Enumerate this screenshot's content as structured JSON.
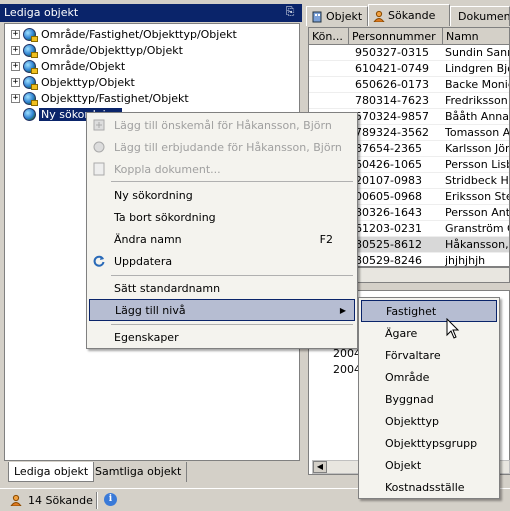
{
  "left_panel": {
    "title": "Lediga objekt",
    "pin_glyph": "↕",
    "tree": [
      {
        "expander": "+",
        "label": "Område/Fastighet/Objekttyp/Objekt"
      },
      {
        "expander": "+",
        "label": "Område/Objekttyp/Objekt"
      },
      {
        "expander": "+",
        "label": "Område/Objekt"
      },
      {
        "expander": "+",
        "label": "Objekttyp/Objekt"
      },
      {
        "expander": "+",
        "label": "Objekttyp/Fastighet/Objekt"
      },
      {
        "expander": "",
        "label": "Ny sökordning"
      }
    ],
    "bottom_tabs": {
      "active": "Lediga objekt",
      "inactive": "Samtliga objekt"
    }
  },
  "right_panel": {
    "tabs": [
      "Objekt",
      "Sökande",
      "Dokument"
    ],
    "grid": {
      "headers": [
        "Kön...",
        "Personnummer",
        "Namn"
      ],
      "rows": [
        {
          "pnr": "950327-0315",
          "name": "Sundin Sanna"
        },
        {
          "pnr": "610421-0749",
          "name": "Lindgren Björn"
        },
        {
          "pnr": "650626-0173",
          "name": "Backe Monica"
        },
        {
          "pnr": "780314-7623",
          "name": "Fredriksson K"
        },
        {
          "pnr": "570324-9857",
          "name": "Bååth Anna"
        },
        {
          "pnr": "789324-3562",
          "name": "Tomasson A..."
        },
        {
          "pnr": "87654-2365",
          "name": "Karlsson Jörg..."
        },
        {
          "pnr": "60426-1065",
          "name": "Persson Lisb..."
        },
        {
          "pnr": "20107-0983",
          "name": "Stridbeck Hel"
        },
        {
          "pnr": "00605-0968",
          "name": "Eriksson Ste..."
        },
        {
          "pnr": "80326-1643",
          "name": "Persson  Ante"
        },
        {
          "pnr": "61203-0231",
          "name": "Granström Co"
        },
        {
          "pnr": "80525-8612",
          "name": "Håkansson, ..."
        },
        {
          "pnr": "80529-8246",
          "name": "jhjhjhjh"
        }
      ]
    },
    "lower_grid_years": [
      "2004",
      "2004"
    ]
  },
  "context_menu": {
    "items": [
      {
        "label": "Lägg till önskemål för Håkansson, Björn",
        "disabled": true,
        "icon": "wish-icon"
      },
      {
        "label": "Lägg till erbjudande för Håkansson, Björn",
        "disabled": true,
        "icon": "offer-icon"
      },
      {
        "label": "Koppla dokument...",
        "disabled": true,
        "icon": "document-icon"
      },
      {
        "label": "Ny sökordning",
        "disabled": false
      },
      {
        "label": "Ta bort sökordning",
        "disabled": false
      },
      {
        "label": "Ändra namn",
        "disabled": false,
        "shortcut": "F2"
      },
      {
        "label": "Uppdatera",
        "disabled": false,
        "icon": "refresh-icon"
      },
      {
        "label": "Sätt standardnamn",
        "disabled": false
      },
      {
        "label": "Lägg till nivå",
        "disabled": false,
        "submenu": true
      },
      {
        "label": "Egenskaper",
        "disabled": false
      }
    ]
  },
  "submenu": {
    "items": [
      "Fastighet",
      "Ägare",
      "Förvaltare",
      "Område",
      "Byggnad",
      "Objekttyp",
      "Objekttypsgrupp",
      "Objekt",
      "Kostnadsställe"
    ]
  },
  "statusbar": {
    "count_text": "14 Sökande"
  },
  "colors": {
    "title_bar": "#0a246a",
    "menu_highlight": "#b6bdd2",
    "face": "#d4d0c8"
  }
}
